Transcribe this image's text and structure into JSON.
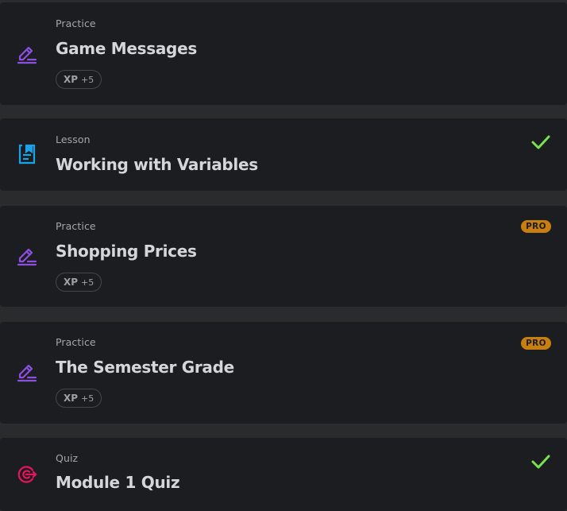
{
  "colors": {
    "background": "#2a2b2d",
    "card": "#1c1d20",
    "practice_icon": "#8d4fe0",
    "lesson_icon": "#1aa3e8",
    "quiz_icon": "#e0155a",
    "check": "#79e34f",
    "pro_badge": "#c97f10"
  },
  "items": [
    {
      "type": "Practice",
      "title": "Game Messages",
      "icon": "pencil-edit-icon",
      "xp_label": "XP",
      "xp_value": "+5",
      "pro": false,
      "completed": false
    },
    {
      "type": "Lesson",
      "title": "Working with Variables",
      "icon": "document-icon",
      "pro": false,
      "completed": true
    },
    {
      "type": "Practice",
      "title": "Shopping Prices",
      "icon": "pencil-edit-icon",
      "xp_label": "XP",
      "xp_value": "+5",
      "pro": true,
      "pro_label": "PRO",
      "completed": false
    },
    {
      "type": "Practice",
      "title": "The Semester Grade",
      "icon": "pencil-edit-icon",
      "xp_label": "XP",
      "xp_value": "+5",
      "pro": true,
      "pro_label": "PRO",
      "completed": false
    },
    {
      "type": "Quiz",
      "title": "Module 1 Quiz",
      "icon": "target-icon",
      "pro": false,
      "completed": true
    }
  ]
}
